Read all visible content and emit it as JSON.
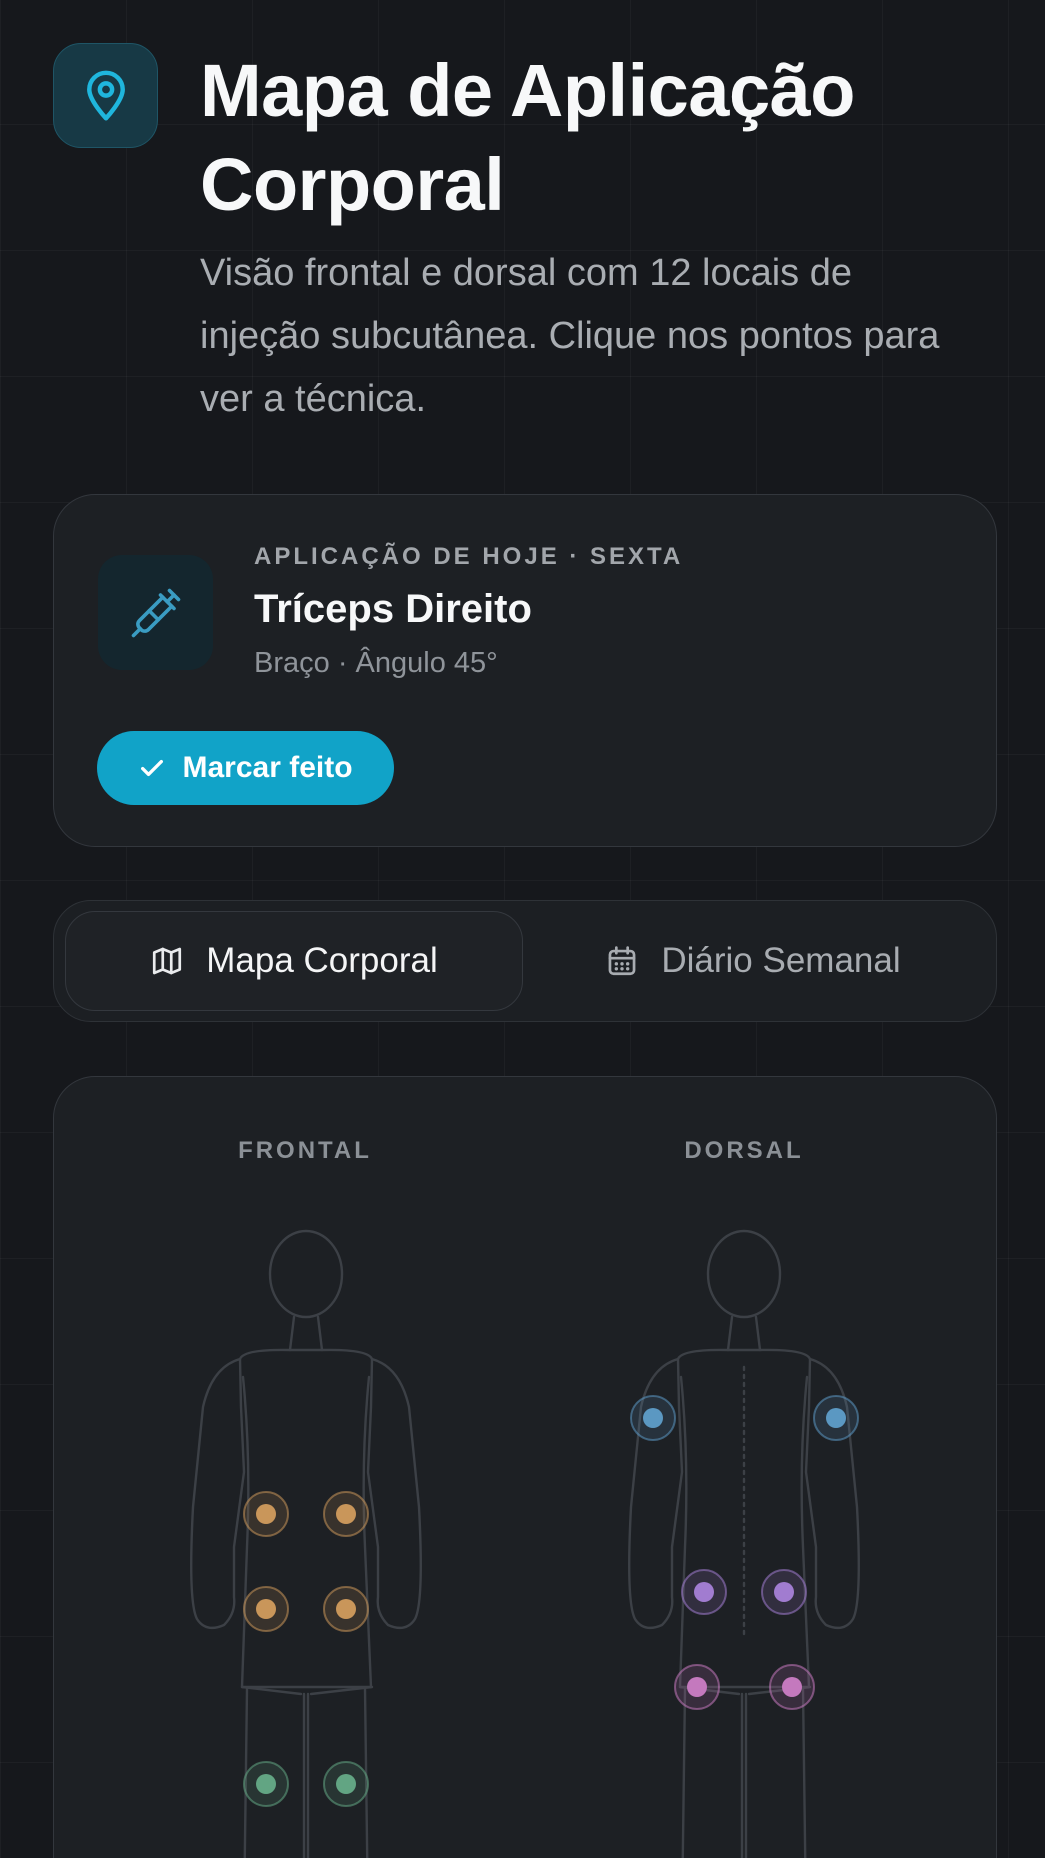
{
  "header": {
    "title": "Mapa de Aplicação Corporal",
    "subtitle": "Visão frontal e dorsal com 12 locais de injeção subcutânea. Clique nos pontos para ver a técnica.",
    "icon": "map-pin-icon"
  },
  "today": {
    "eyebrow": "APLICAÇÃO DE HOJE · SEXTA",
    "site": "Tríceps Direito",
    "details": "Braço · Ângulo 45°",
    "icon": "syringe-icon",
    "done_label": "Marcar feito",
    "done_icon": "check-icon"
  },
  "tabs": [
    {
      "label": "Mapa Corporal",
      "icon": "map-icon",
      "active": true
    },
    {
      "label": "Diário Semanal",
      "icon": "calendar-icon",
      "active": false
    }
  ],
  "map": {
    "front_label": "FRONTAL",
    "back_label": "DORSAL",
    "colors": {
      "abdomen": "#c9965a",
      "thigh": "#62a583",
      "triceps": "#5b98c2",
      "flank": "#a17cd0",
      "glute": "#c479be",
      "accent": "#11a3c8"
    }
  }
}
